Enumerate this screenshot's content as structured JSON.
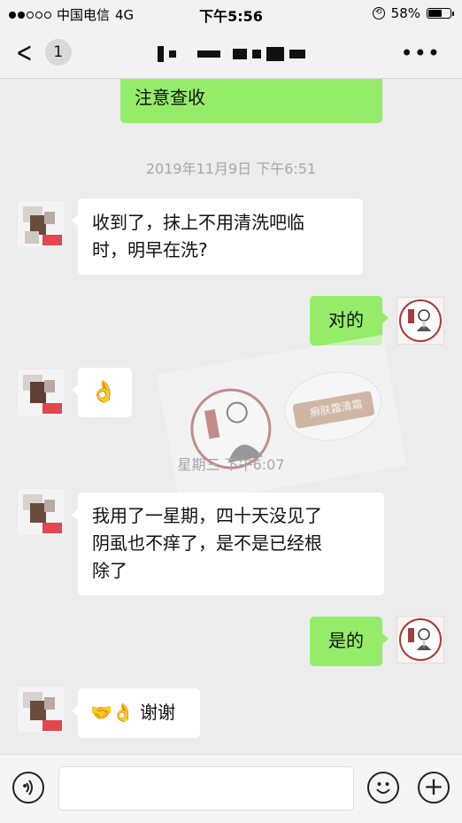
{
  "status_bar": {
    "carrier": "中国电信",
    "network": "4G",
    "time": "下午5:56",
    "battery": "58%",
    "battery_level": 0.58
  },
  "nav": {
    "back_count": "1",
    "more_label": "•••"
  },
  "messages": [
    {
      "side": "out",
      "text": "注意查收"
    },
    {
      "timestamp": "2019年11月9日 下午6:51"
    },
    {
      "side": "in",
      "text_lines": [
        "收到了，抹上不用清洗吧临",
        "时，明早在洗?"
      ]
    },
    {
      "side": "out",
      "text": "对的"
    },
    {
      "side": "in",
      "text": "👌"
    },
    {
      "timestamp": "星期三 下午6:07"
    },
    {
      "side": "in",
      "text_lines": [
        "我用了一星期，四十天没见了",
        "阴虱也不痒了，是不是已经根",
        "除了"
      ]
    },
    {
      "side": "out",
      "text": "是的"
    },
    {
      "side": "in",
      "text": "🤝👌 谢谢"
    }
  ],
  "watermark": {
    "product_label": "癣肤霜清霜"
  },
  "colors": {
    "accent_green": "#95ec69",
    "background": "#ececec",
    "incoming": "#ffffff"
  },
  "icons": [
    "voice-icon",
    "emoji-icon",
    "plus-icon",
    "back-chevron-icon",
    "more-icon"
  ]
}
